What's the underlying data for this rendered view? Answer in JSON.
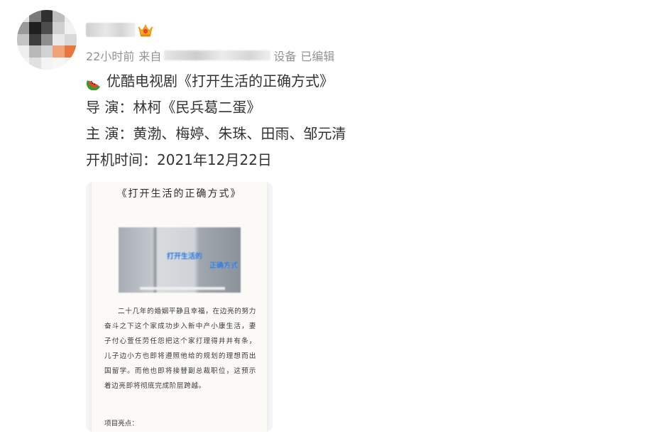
{
  "author": {
    "avatar_colors": [
      "#e6e6e6",
      "#7a7a7a",
      "#2f2f2f",
      "#bdbdbd",
      "#ededed",
      "#9a9a9a",
      "#1f1f1f",
      "#4d4d4d",
      "#d0d0d0",
      "#f2f2f2",
      "#c4c4c4",
      "#3d3d3d",
      "#8f8f8f",
      "#e9e9e9",
      "#d8d8d8",
      "#efefef",
      "#b9b9b9",
      "#d2d2d2",
      "#f0a37a",
      "#e8763f",
      "#f5f5f5",
      "#e1e1e1",
      "#f3f3f3",
      "#f7f7f7",
      "#f1f1f1"
    ],
    "badge_icon": "vip-crown-icon"
  },
  "meta": {
    "time": "22小时前",
    "from_prefix": "来自",
    "device_suffix": "设备",
    "edited": "已编辑"
  },
  "post": {
    "emoji_icon": "watermelon-icon",
    "title": "优酷电视剧《打开生活的正确方式》",
    "director": "导 演：林柯《民兵葛二蛋》",
    "cast": "主 演：黄渤、梅婷、朱珠、田雨、邹元清",
    "start_date": "开机时间：2021年12月22日"
  },
  "image": {
    "doc_title": "《打开生活的正确方式》",
    "cover_title_line1": "打开生活的",
    "cover_title_line2": "正确方式",
    "paragraph": "二十几年的婚姻平静且幸福，在边亮的努力奋斗之下这个家成功步入新中产小康生活，妻子付心萱任劳任怨把这个家打理得井井有条，儿子边小方也即将遵照他给的规划的理想而出国留学。而他也即将接替副总裁职位，这预示着边亮即将彻底完成阶层跨越。",
    "section_heading": "项目亮点："
  }
}
